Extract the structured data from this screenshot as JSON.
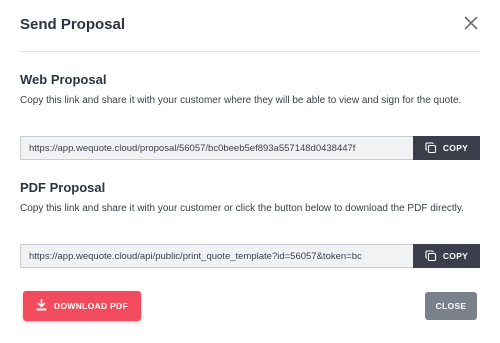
{
  "dialog": {
    "title": "Send Proposal",
    "close_icon": "close-icon"
  },
  "web_proposal": {
    "title": "Web Proposal",
    "description": "Copy this link and share it with your customer where they will be able to view and sign for the quote.",
    "link": "https://app.wequote.cloud/proposal/56057/bc0beeb5ef893a557148d0438447f",
    "copy_label": "COPY"
  },
  "pdf_proposal": {
    "title": "PDF Proposal",
    "description": "Copy this link and share it with your customer or click the button below to download the PDF directly.",
    "link": "https://app.wequote.cloud/api/public/print_quote_template?id=56057&token=bc",
    "copy_label": "COPY"
  },
  "footer": {
    "download_label": "DOWNLOAD PDF",
    "close_label": "CLOSE"
  },
  "colors": {
    "accent": "#f24b5d",
    "copy_button": "#3a3f4b",
    "close_button": "#7b818b"
  }
}
